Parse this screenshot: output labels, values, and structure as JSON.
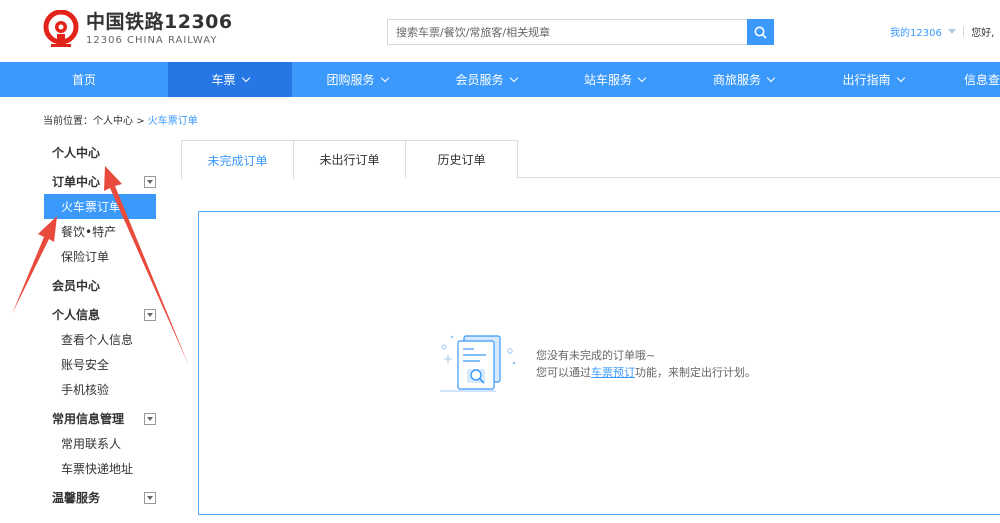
{
  "header": {
    "logo": {
      "name_cn": "中国铁路12306",
      "name_en": "12306 CHINA RAILWAY",
      "brand_color": "#e2231a"
    },
    "search": {
      "placeholder": "搜索车票/餐饮/常旅客/相关规章",
      "icon": "search-icon"
    },
    "my_account": "我的12306",
    "greeting": "您好,"
  },
  "nav": {
    "items": [
      {
        "label": "首页",
        "dropdown": false
      },
      {
        "label": "车票",
        "dropdown": true,
        "active": true
      },
      {
        "label": "团购服务",
        "dropdown": true
      },
      {
        "label": "会员服务",
        "dropdown": true
      },
      {
        "label": "站车服务",
        "dropdown": true
      },
      {
        "label": "商旅服务",
        "dropdown": true
      },
      {
        "label": "出行指南",
        "dropdown": true
      },
      {
        "label": "信息查",
        "dropdown": false
      }
    ]
  },
  "breadcrumb": {
    "prefix": "当前位置：",
    "parent": "个人中心",
    "separator": ">",
    "current": "火车票订单"
  },
  "sidebar": {
    "personal_center": "个人中心",
    "order_center": "订单中心",
    "order_items": [
      "火车票订单",
      "餐饮•特产",
      "保险订单"
    ],
    "member_center": "会员中心",
    "personal_info": "个人信息",
    "info_items": [
      "查看个人信息",
      "账号安全",
      "手机核验"
    ],
    "common_info": "常用信息管理",
    "common_items": [
      "常用联系人",
      "车票快递地址"
    ],
    "warm_service": "温馨服务"
  },
  "tabs": [
    "未完成订单",
    "未出行订单",
    "历史订单"
  ],
  "empty_state": {
    "line1": "您没有未完成的订单哦~",
    "line2_prefix": "您可以通过",
    "line2_link": "车票预订",
    "line2_suffix": "功能，来制定出行计划。"
  },
  "colors": {
    "accent": "#3b99fc",
    "nav_active": "#2676e3",
    "arrow_red": "#e84a3c"
  }
}
